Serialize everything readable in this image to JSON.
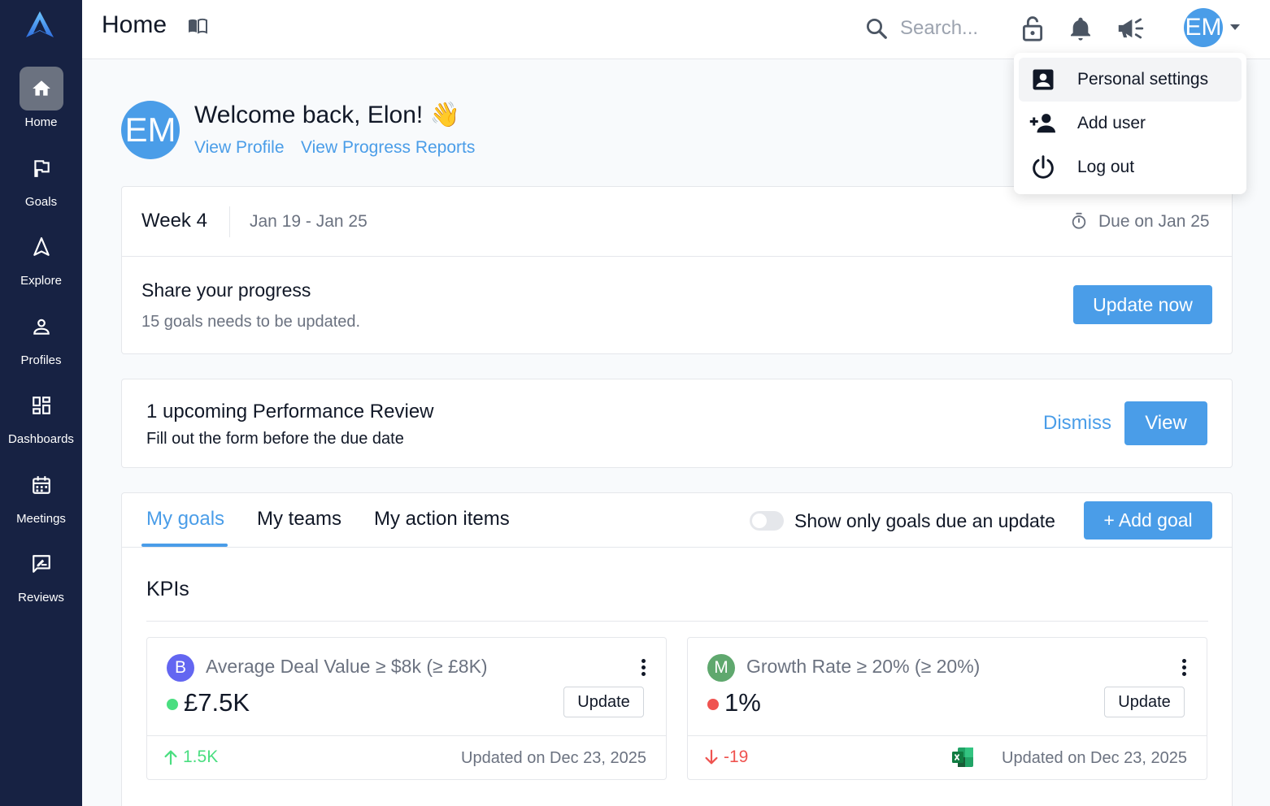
{
  "header": {
    "title": "Home",
    "search_placeholder": "Search...",
    "avatar_initials": "EM"
  },
  "sidebar": {
    "items": [
      {
        "label": "Home",
        "icon": "home-icon",
        "active": true
      },
      {
        "label": "Goals",
        "icon": "flag-icon"
      },
      {
        "label": "Explore",
        "icon": "navigation-icon"
      },
      {
        "label": "Profiles",
        "icon": "person-icon"
      },
      {
        "label": "Dashboards",
        "icon": "dashboard-icon"
      },
      {
        "label": "Meetings",
        "icon": "calendar-icon"
      },
      {
        "label": "Reviews",
        "icon": "review-icon"
      }
    ]
  },
  "user_menu": {
    "items": [
      {
        "label": "Personal settings",
        "icon": "account-box-icon"
      },
      {
        "label": "Add user",
        "icon": "person-add-icon"
      },
      {
        "label": "Log out",
        "icon": "power-icon"
      }
    ]
  },
  "welcome": {
    "avatar_initials": "EM",
    "title": "Welcome back, Elon! 👋",
    "view_profile": "View Profile",
    "view_progress": "View Progress Reports"
  },
  "week": {
    "label": "Week 4",
    "range": "Jan 19 - Jan 25",
    "due": "Due on Jan 25",
    "share_title": "Share your progress",
    "share_subtitle": "15 goals needs to be updated.",
    "update_button": "Update now"
  },
  "review": {
    "title": "1 upcoming Performance Review",
    "subtitle": "Fill out the form before the due date",
    "dismiss": "Dismiss",
    "view": "View"
  },
  "goals": {
    "tabs": [
      "My goals",
      "My teams",
      "My action items"
    ],
    "toggle_label": "Show only goals due an update",
    "add_goal": "+ Add goal",
    "section_title": "KPIs",
    "kpis": [
      {
        "badge": "B",
        "badge_color": "#6366f1",
        "title": "Average Deal Value ≥ $8k  (≥ £8K)",
        "value": "£7.5K",
        "status_color": "#4ade80",
        "update": "Update",
        "delta": "1.5K",
        "delta_color": "#4ade80",
        "updated": "Updated on Dec 23, 2025"
      },
      {
        "badge": "M",
        "badge_color": "#5fa86e",
        "title": "Growth Rate ≥ 20%  (≥ 20%)",
        "value": "1%",
        "status_color": "#ef5350",
        "update": "Update",
        "delta": "-19",
        "delta_color": "#ef5350",
        "updated": "Updated on Dec 23, 2025"
      }
    ]
  },
  "colors": {
    "sidebar_bg": "#172243",
    "accent": "#4a9de8"
  }
}
